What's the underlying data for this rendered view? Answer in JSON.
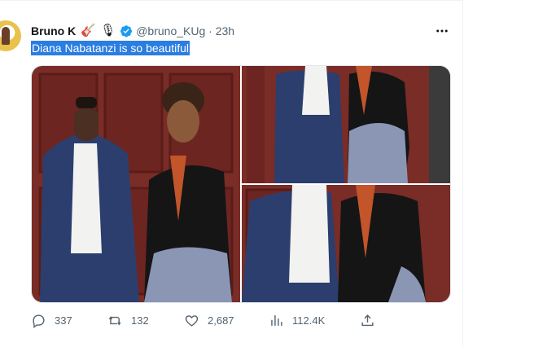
{
  "tweet": {
    "author_name": "Bruno K",
    "author_emojis": [
      "🎸",
      "🎙"
    ],
    "handle_time": "@bruno_KUg · 23h",
    "text": "Diana Nabatanzi is so beautiful",
    "selection_color": "#2a7de1"
  },
  "actions": {
    "replies": "337",
    "retweets": "132",
    "likes": "2,687",
    "views": "112.4K"
  },
  "icons": [
    "more-icon",
    "verified-icon",
    "reply-icon",
    "retweet-icon",
    "like-icon",
    "views-icon",
    "share-icon"
  ],
  "colors": {
    "verified": "#1d9bf0",
    "secondary_text": "#536471",
    "door_wood": "#7a2c26",
    "suit": "#2c3e6e"
  }
}
